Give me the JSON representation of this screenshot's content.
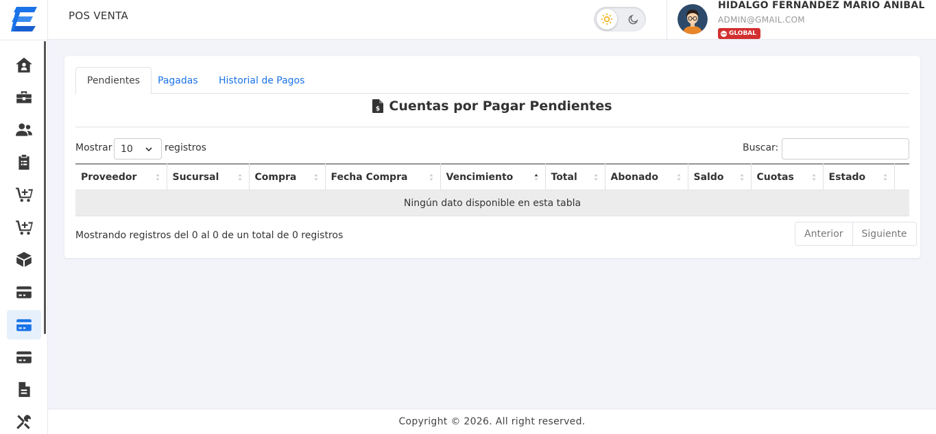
{
  "app": {
    "title": "POS VENTA"
  },
  "user": {
    "name": "HIDALGO FERNANDEZ MARIO ANIBAL",
    "email": "ADMIN@GMAIL.COM",
    "badge": "GLOBAL"
  },
  "sidebar": {
    "items": [
      {
        "icon": "home-icon",
        "active": false
      },
      {
        "icon": "briefcase-icon",
        "active": false
      },
      {
        "icon": "users-icon",
        "active": false
      },
      {
        "icon": "clipboard-icon",
        "active": false
      },
      {
        "icon": "cart-plus-icon",
        "active": false
      },
      {
        "icon": "cart-plus-icon",
        "active": false
      },
      {
        "icon": "box-icon",
        "active": false
      },
      {
        "icon": "credit-card-icon",
        "active": false
      },
      {
        "icon": "credit-card-icon",
        "active": true
      },
      {
        "icon": "credit-card-icon",
        "active": false
      },
      {
        "icon": "file-icon",
        "active": false
      },
      {
        "icon": "tools-icon",
        "active": false
      }
    ]
  },
  "tabs": [
    {
      "label": "Pendientes",
      "active": true
    },
    {
      "label": "Pagadas",
      "active": false
    },
    {
      "label": "Historial de Pagos",
      "active": false
    }
  ],
  "card": {
    "title": "Cuentas por Pagar Pendientes",
    "title_icon": "file-invoice-dollar-icon"
  },
  "table": {
    "length_label": "Mostrar",
    "length_value": "10",
    "length_suffix": "registros",
    "search_label": "Buscar:",
    "search_value": "",
    "columns": [
      "Proveedor",
      "Sucursal",
      "Compra",
      "Fecha Compra",
      "Vencimiento",
      "Total",
      "Abonado",
      "Saldo",
      "Cuotas",
      "Estado"
    ],
    "sorted_column": "Vencimiento",
    "empty_message": "Ningún dato disponible en esta tabla",
    "info": "Mostrando registros del 0 al 0 de un total de 0 registros",
    "prev_label": "Anterior",
    "next_label": "Siguiente"
  },
  "footer": {
    "text": "Copyright © 2026. All right reserved."
  },
  "colors": {
    "accent": "#1a73e8",
    "badge": "#d32f2f",
    "background": "#f2f4fa"
  }
}
